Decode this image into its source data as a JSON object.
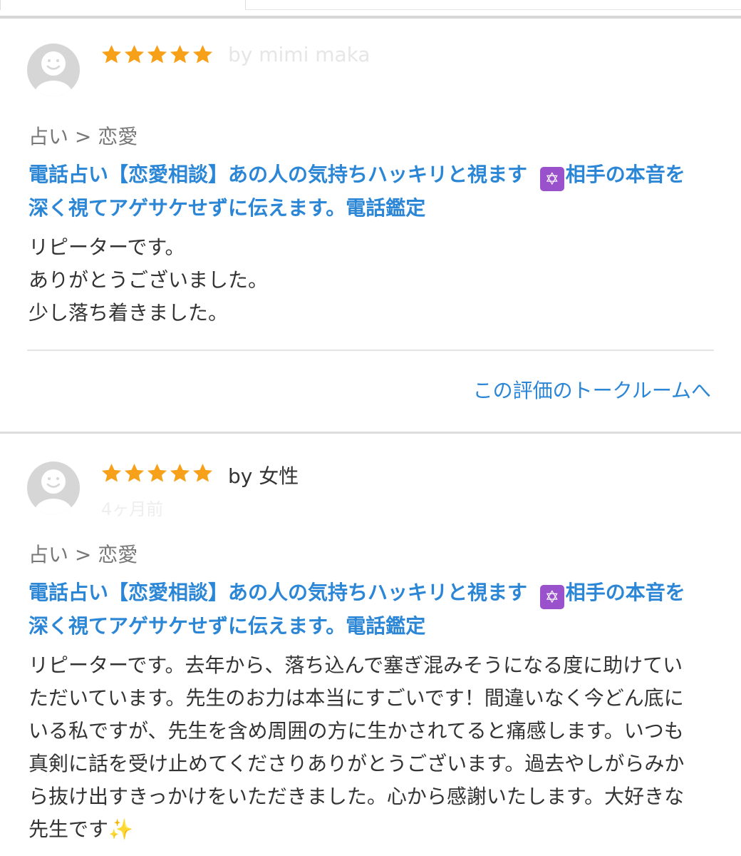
{
  "reviews": [
    {
      "rating": 5,
      "author": "by mimi maka",
      "category": "占い > 恋愛",
      "title_part1": "電話占い【恋愛相談】あの人の気持ちハッキリと視ます ",
      "title_emoji": "✡",
      "title_part2": "相手の本音を",
      "title_line2": "深く視てアゲサケせずに伝えます。電話鑑定",
      "body_lines": [
        "リピーターです。",
        "ありがとうございました。",
        "少し落ち着きました。"
      ],
      "link_label": "この評価のトークルームへ"
    },
    {
      "rating": 5,
      "author": "by 女性",
      "time_ago": "4ヶ月前",
      "category": "占い > 恋愛",
      "title_part1": "電話占い【恋愛相談】あの人の気持ちハッキリと視ます ",
      "title_emoji": "✡",
      "title_part2": "相手の本音を",
      "title_line2": "深く視てアゲサケせずに伝えます。電話鑑定",
      "body_lines": [
        "リピーターです。去年から、落ち込んで塞ぎ混みそうになる度に助けてい",
        "ただいています。先生のお力は本当にすごいです！間違いなく今どん底に",
        "いる私ですが、先生を含め周囲の方に生かされてると痛感します。いつも",
        "真剣に話を受け止めてくださりありがとうございます。過去やしがらみか",
        "ら抜け出すきっかけをいただきました。心から感謝いたします。大好きな",
        "先生です"
      ],
      "body_emoji": "✨"
    }
  ],
  "colors": {
    "accent": "#2b86d6",
    "star": "#f7a11a",
    "badge": "#9a52cc"
  }
}
